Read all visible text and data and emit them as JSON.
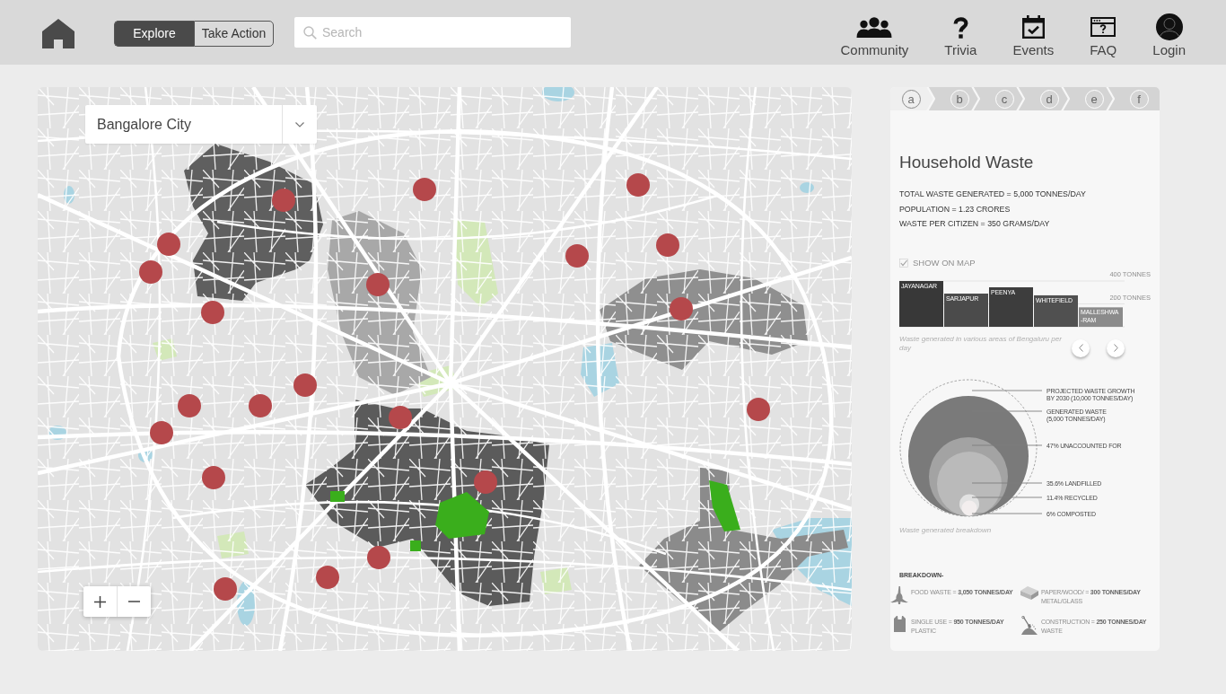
{
  "header": {
    "mode_tabs": [
      {
        "label": "Explore",
        "selected": true
      },
      {
        "label": "Take Action",
        "selected": false
      }
    ],
    "search": {
      "placeholder": "Search"
    },
    "nav": [
      {
        "label": "Community",
        "kind": "community"
      },
      {
        "label": "Trivia",
        "kind": "trivia"
      },
      {
        "label": "Events",
        "kind": "events"
      },
      {
        "label": "FAQ",
        "kind": "faq"
      },
      {
        "label": "Login",
        "kind": "login"
      }
    ]
  },
  "map": {
    "city_select": {
      "value": "Bangalore City"
    }
  },
  "panel": {
    "steps": [
      {
        "label": "a",
        "selected": true
      },
      {
        "label": "b",
        "selected": false
      },
      {
        "label": "c",
        "selected": false
      },
      {
        "label": "d",
        "selected": false
      },
      {
        "label": "e",
        "selected": false
      },
      {
        "label": "f",
        "selected": false
      }
    ],
    "title": "Household Waste",
    "stats": [
      "TOTAL WASTE GENERATED = 5,000 TONNES/DAY",
      "POPULATION = 1.23 CRORES",
      "WASTE PER CITIZEN = 350 GRAMS/DAY"
    ],
    "show_on_map": {
      "label": "SHOW ON MAP",
      "checked": true,
      "disabled": true
    },
    "area_chart": {
      "chart_data": {
        "type": "bar",
        "categories": [
          "JAYANAGAR",
          "SARJAPUR",
          "PEENYA",
          "WHITEFIELD",
          "MALLESHWA -RAM"
        ],
        "values": [
          400,
          290,
          345,
          275,
          170
        ],
        "ylim": [
          0,
          400
        ],
        "yticks": [
          {
            "value": 200,
            "label": "200 TONNES"
          },
          {
            "value": 400,
            "label": "400 TONNES"
          }
        ]
      },
      "caption": "Waste generated in various areas of Bengaluru per day"
    },
    "waste_breakdown": {
      "bubbles": [
        {
          "kind": "outline",
          "color": "#999999",
          "label_lines": [
            "PROJECTED WASTE GROWTH",
            "BY 2030 (10,000 TONNES/DAY)"
          ]
        },
        {
          "kind": "filled",
          "color": "#7a7a7a",
          "label_lines": [
            "GENERATED WASTE",
            "(5,000 TONNES/DAY)"
          ]
        },
        {
          "kind": "filled",
          "color": "#a3a3a3",
          "label_lines": [
            "47% UNACCOUNTED FOR"
          ]
        },
        {
          "kind": "filled",
          "color": "#bababa",
          "label_lines": [
            "35.6% LANDFILLED"
          ]
        },
        {
          "kind": "filled",
          "color": "#e2e2e2",
          "label_lines": [
            "11.4% RECYCLED"
          ]
        },
        {
          "kind": "filled",
          "color": "#f3eeee",
          "label_lines": [
            "6% COMPOSTED"
          ]
        }
      ],
      "caption": "Waste generated breakdown"
    },
    "breakdown": {
      "title": "BREAKDOWN-",
      "items": [
        {
          "kind": "food",
          "line_1": "FOOD WASTE = **3,050 TONNES/DAY**"
        },
        {
          "kind": "paper",
          "line_1": "PAPER/WOOD/ = **300 TONNES/DAY**",
          "line_2": "METAL/GLASS"
        },
        {
          "kind": "plastic",
          "line_1": "SINGLE USE = **950 TONNES/DAY**",
          "line_2": "PLASTIC"
        },
        {
          "kind": "construction",
          "line_1": "CONSTRUCTION = **250 TONNES/DAY**",
          "line_2": "WASTE"
        }
      ]
    }
  }
}
